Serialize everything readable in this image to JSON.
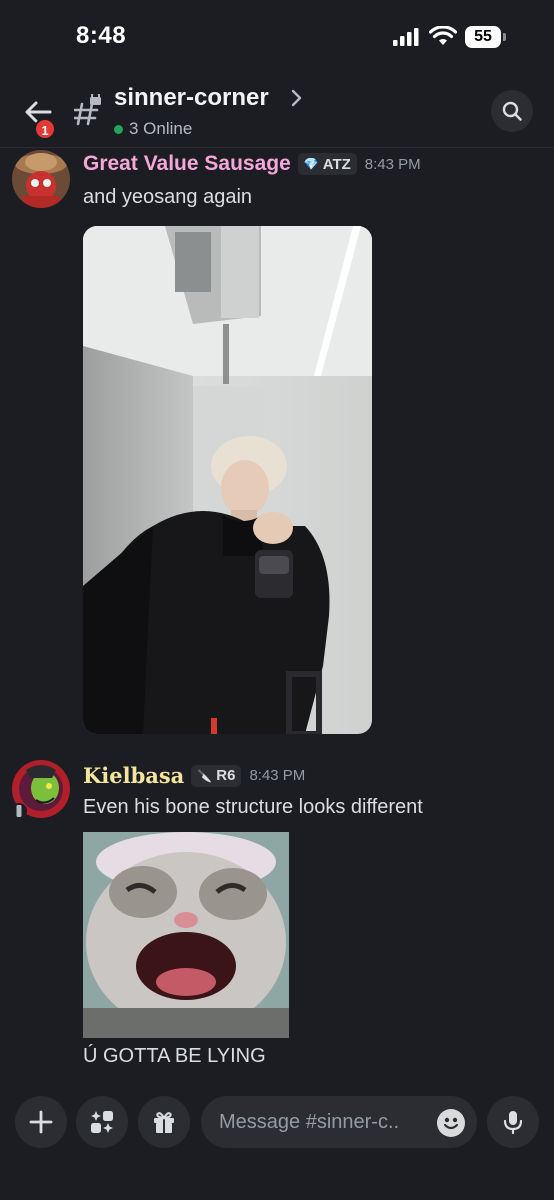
{
  "status_bar": {
    "time": "8:48",
    "battery": "55"
  },
  "header": {
    "channel_name": "sinner-corner",
    "online_text": "3 Online",
    "back_badge_count": "1"
  },
  "messages": [
    {
      "author": "Great Value Sausage",
      "author_color": "#f4a7d8",
      "tag": "ATZ",
      "tag_icon": "diamond-icon",
      "timestamp": "8:43 PM",
      "text": "and yeosang again",
      "attachment": "photo"
    },
    {
      "author": "Kielbasa",
      "author_color": "#f3e59b",
      "tag": "R6",
      "tag_icon": "knife-icon",
      "timestamp": "8:43 PM",
      "text": "Even his bone structure looks different",
      "attachment": "image",
      "followup_text": "Ú GOTTA BE LYING"
    }
  ],
  "composer": {
    "placeholder": "Message #sinner-c.."
  },
  "colors": {
    "background": "#1c1d22",
    "online": "#23a55a",
    "badge": "#e53935"
  }
}
